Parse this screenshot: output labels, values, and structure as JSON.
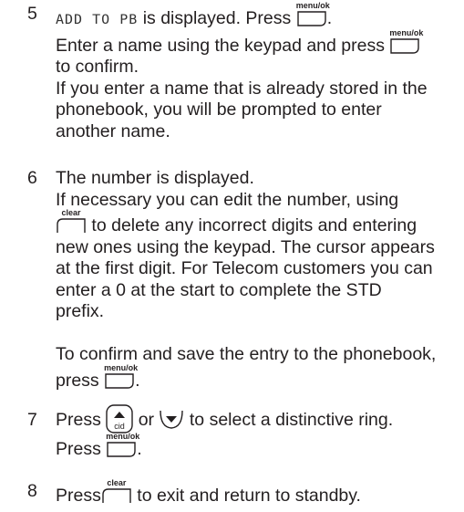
{
  "steps": [
    {
      "number": "5",
      "lines": [
        {
          "lcd": "ADD TO PB",
          "after": " is displayed. Press",
          "key": "menu/ok",
          "end": "."
        },
        {
          "text": "Enter a name using the keypad and press",
          "key": "menu/ok"
        },
        {
          "text": "to confirm."
        },
        {
          "text": "If you enter a name that is already stored in the"
        },
        {
          "text": "phonebook, you will be prompted to enter"
        },
        {
          "text": "another name."
        }
      ]
    },
    {
      "number": "6",
      "lines": [
        {
          "text": "The number is displayed."
        },
        {
          "text": "If necessary you can edit the number, using"
        },
        {
          "key": "clear",
          "text": " to delete any incorrect digits and entering"
        },
        {
          "text": "new ones using the keypad. The cursor appears"
        },
        {
          "text": "at the first digit. For Telecom customers you can"
        },
        {
          "text": "enter a 0 at the start to complete the STD"
        },
        {
          "text": "prefix."
        },
        {
          "text": ""
        },
        {
          "text": "To confirm and save the entry to the phonebook,"
        },
        {
          "text": "press",
          "key": "menu/ok",
          "end": "."
        }
      ]
    },
    {
      "number": "7",
      "lines": [
        {
          "text": "Press",
          "key": "cid",
          "mid": " or ",
          "key2": "down",
          "after2": " to select a distinctive ring."
        },
        {
          "text": "Press",
          "key": "menu/ok",
          "end": "."
        }
      ]
    },
    {
      "number": "8",
      "lines": [
        {
          "text": "Press",
          "key": "clear",
          "after": " to exit and return to standby."
        }
      ]
    }
  ],
  "key_labels": {
    "menu_ok": "menu/ok",
    "clear": "clear",
    "cid": "cid"
  }
}
